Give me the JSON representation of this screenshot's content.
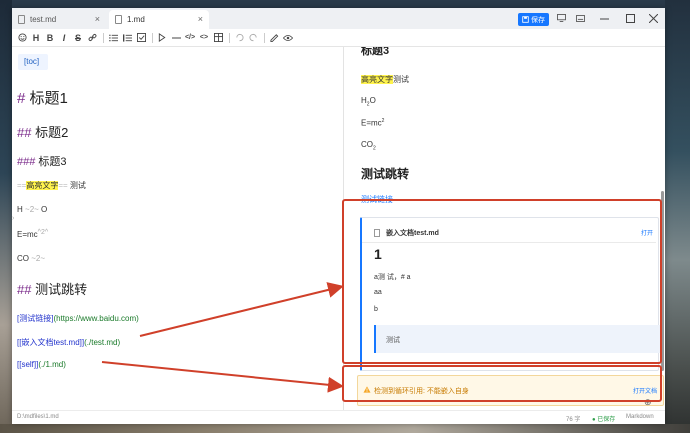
{
  "tabs": [
    {
      "name": "test.md"
    },
    {
      "name": "1.md"
    }
  ],
  "toolbar_right": {
    "save_label": "保存"
  },
  "toolbar": [
    "emoji",
    "bold",
    "italic",
    "strike",
    "link",
    "ul",
    "ol",
    "task",
    "quote",
    "hr",
    "code",
    "codeblock",
    "table",
    "undo",
    "redo",
    "settings",
    "preview"
  ],
  "editor": {
    "toc": "[toc]",
    "h1_hash": "#",
    "h1_text": "标题1",
    "h2_hash": "##",
    "h2_text": "标题2",
    "h3_hash": "###",
    "h3_text": "标题3",
    "hl_mark_open": "==",
    "hl_text": "高亮文字",
    "hl_mark_close": "==",
    "hl_after": "测试",
    "water_h": "H",
    "water_mark": "~2~",
    "water_o": "O",
    "emc_text": "E=mc",
    "emc_mark": "^2^",
    "co_text": "CO",
    "co_mark": "~2~",
    "h2b_hash": "##",
    "h2b_text": "测试跳转",
    "link1_text": "[测试链接]",
    "link1_url": "(https://www.baidu.com)",
    "link2_text": "[[嵌入文档test.md]]",
    "link2_url": "(./test.md)",
    "link3_text": "[[self]]",
    "link3_url": "(./1.md)"
  },
  "preview": {
    "partial_heading": "标题3",
    "hl_text": "高亮文字",
    "hl_after": "测试",
    "water": "H",
    "water_sub": "2",
    "water_o": "O",
    "emc": "E=mc",
    "emc_sup": "2",
    "co": "CO",
    "co_sub": "2",
    "h2": "测试跳转",
    "link_text": "测试链接",
    "embed": {
      "title": "嵌入文档test.md",
      "open_label": "打开",
      "h1": "1",
      "line1": "a测 试，# a",
      "line2": "aa",
      "line3": "b",
      "quote": "测试"
    },
    "warning": {
      "text": "检测到循环引用: 不能嵌入自身",
      "action": "打开文档"
    }
  },
  "status": {
    "path": "D:\\mdfiles\\1.md",
    "words": "76 字",
    "saved": "● 已保存",
    "mode": "Markdown"
  },
  "colors": {
    "accent": "#1677ff",
    "heading_hash": "#7a2a8a",
    "annotation": "#d0402a",
    "highlight": "#fff34d"
  }
}
